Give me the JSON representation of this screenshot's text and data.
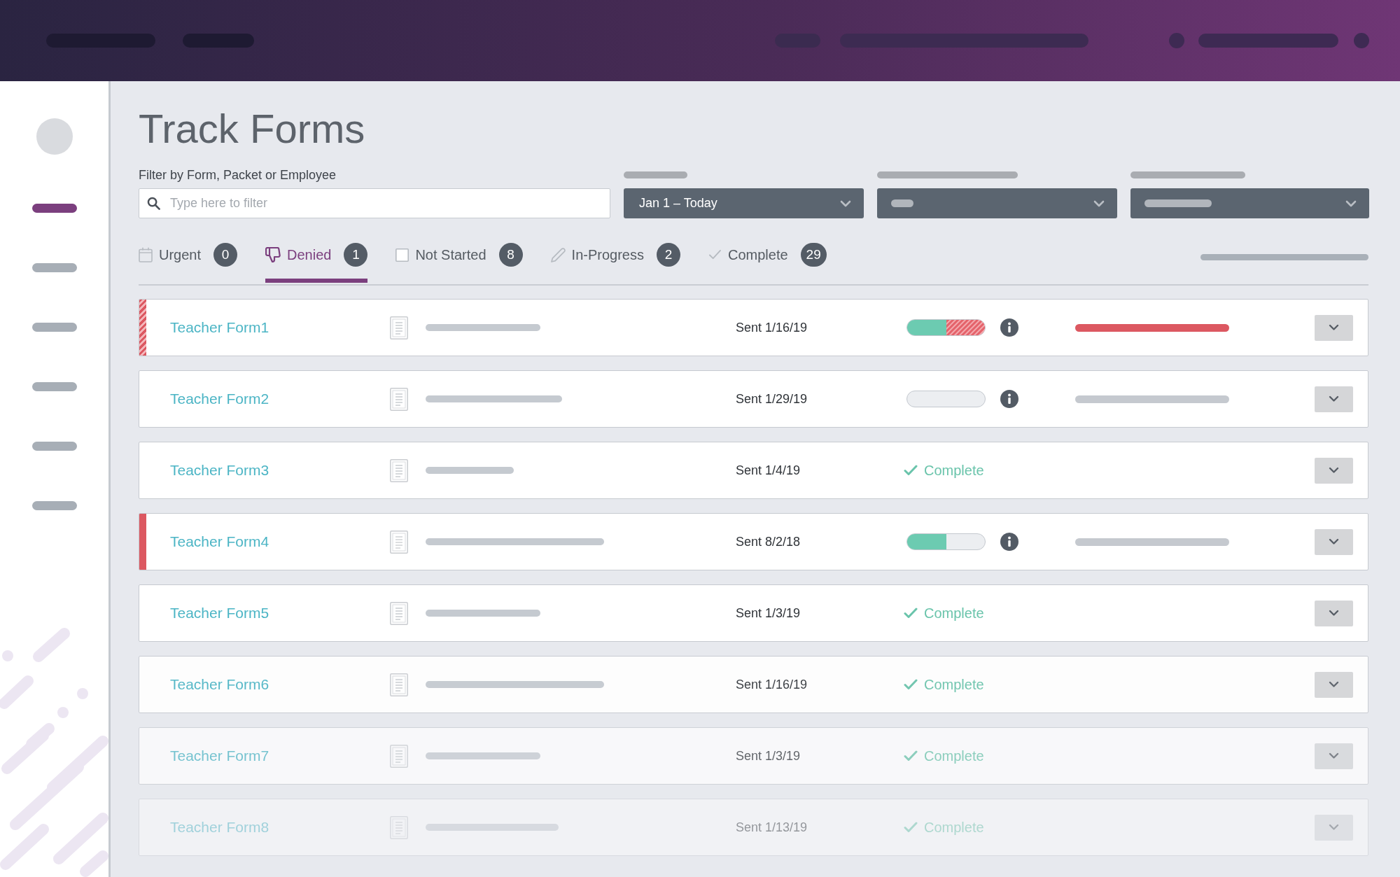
{
  "sidebar": {
    "items": [
      {
        "selected": true
      },
      {
        "selected": false
      },
      {
        "selected": false
      },
      {
        "selected": false
      },
      {
        "selected": false
      },
      {
        "selected": false
      }
    ]
  },
  "page": {
    "title": "Track Forms"
  },
  "filter": {
    "label": "Filter by Form, Packet or Employee",
    "search": {
      "placeholder": "Type here to filter"
    },
    "date_range": {
      "value": "Jan 1 – Today"
    }
  },
  "tabs": [
    {
      "kind": "calendar",
      "label": "Urgent",
      "count": "0",
      "selected": false
    },
    {
      "kind": "thumbs-down",
      "label": "Denied",
      "count": "1",
      "selected": true
    },
    {
      "kind": "checkbox",
      "label": "Not Started",
      "count": "8",
      "selected": false
    },
    {
      "kind": "pencil",
      "label": "In-Progress",
      "count": "2",
      "selected": false
    },
    {
      "kind": "check",
      "label": "Complete",
      "count": "29",
      "selected": false
    }
  ],
  "rows": [
    {
      "name": "Teacher Form1",
      "sent": "Sent 1/16/19",
      "flagged": true,
      "status": {
        "kind": "progress",
        "level": 0.5,
        "denied": true
      }
    },
    {
      "name": "Teacher Form2",
      "sent": "Sent 1/29/19",
      "flagged": false,
      "status": {
        "kind": "progress",
        "denied": false
      }
    },
    {
      "name": "Teacher Form3",
      "sent": "Sent 1/4/19",
      "flagged": false,
      "status": {
        "kind": "complete",
        "label": "Complete"
      }
    },
    {
      "name": "Teacher Form4",
      "sent": "Sent 8/2/18",
      "flagged": true,
      "status": {
        "kind": "progress",
        "level": 0.5,
        "denied": false
      }
    },
    {
      "name": "Teacher Form5",
      "sent": "Sent 1/3/19",
      "flagged": false,
      "status": {
        "kind": "complete",
        "label": "Complete"
      }
    },
    {
      "name": "Teacher Form6",
      "sent": "Sent 1/16/19",
      "flagged": false,
      "status": {
        "kind": "complete",
        "label": "Complete"
      }
    },
    {
      "name": "Teacher Form7",
      "sent": "Sent 1/3/19",
      "flagged": false,
      "status": {
        "kind": "complete",
        "label": "Complete"
      }
    },
    {
      "name": "Teacher Form8",
      "sent": "Sent 1/13/19",
      "flagged": false,
      "status": {
        "kind": "complete",
        "label": "Complete"
      }
    }
  ]
}
